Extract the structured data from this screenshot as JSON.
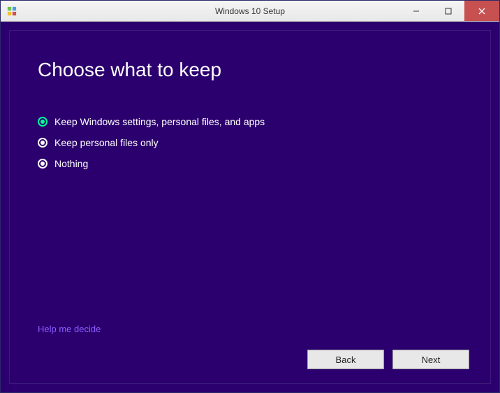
{
  "window": {
    "title": "Windows 10 Setup"
  },
  "main": {
    "heading": "Choose what to keep",
    "options": [
      {
        "label": "Keep Windows settings, personal files, and apps",
        "selected": true
      },
      {
        "label": "Keep personal files only",
        "selected": false
      },
      {
        "label": "Nothing",
        "selected": false
      }
    ],
    "help_link": "Help me decide"
  },
  "buttons": {
    "back": "Back",
    "next": "Next"
  }
}
